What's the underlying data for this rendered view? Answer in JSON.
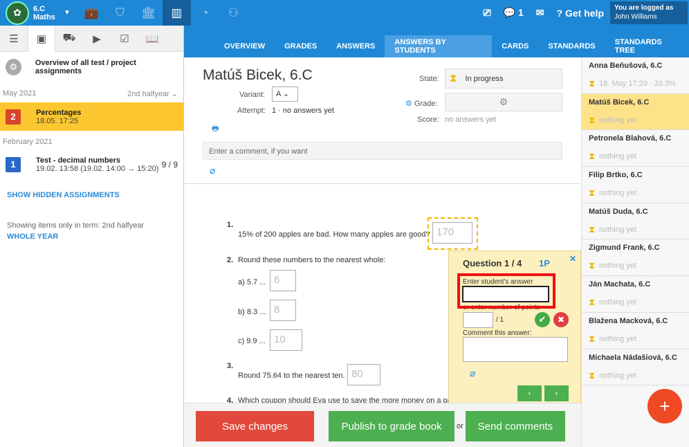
{
  "topbar": {
    "class_name": "6.C",
    "subject": "Maths",
    "unread_count": "1",
    "help": "Get help",
    "logged_as": "You are logged as",
    "user": "John Williams"
  },
  "left": {
    "overview": "Overview of all test / project assignments",
    "sec1": "May 2021",
    "term": "2nd halfyear",
    "a1": {
      "num": "2",
      "title": "Percentages",
      "date": "18.05. 17:25"
    },
    "sec2": "February 2021",
    "a2": {
      "num": "1",
      "title": "Test - decimal numbers",
      "date": "19.02. 13:58 (19.02. 14:00 → 15:20)",
      "score": "9 / 9"
    },
    "show_hidden": "SHOW HIDDEN ASSIGNMENTS",
    "showing": "Showing items only in term: 2nd halfyear",
    "whole_year": "WHOLE YEAR"
  },
  "tabs": [
    "OVERVIEW",
    "GRADES",
    "ANSWERS",
    "ANSWERS BY STUDENTS",
    "CARDS",
    "STANDARDS",
    "STANDARDS TREE"
  ],
  "main": {
    "student": "Matúš Bicek, 6.C",
    "variant_lbl": "Variant:",
    "variant": "A",
    "attempt_lbl": "Attempt:",
    "attempt": "1 · no answers yet",
    "state_lbl": "State:",
    "state": "In progress",
    "grade_lbl": "Grade:",
    "score_lbl": "Score:",
    "score": "no answers yet",
    "comment_placeholder": "Enter a comment, if you want"
  },
  "questions": {
    "q1": "1.",
    "q1t": "15% of 200 apples are bad. How many apples are good?",
    "a1": "170",
    "q2": "2.",
    "q2t": "Round these numbers to the nearest whole:",
    "q2a": "a) 5.7 ...",
    "v2a": "6",
    "q2b": "b) 8.3 ...",
    "v2b": "8",
    "q2c": "c) 9.9 ...",
    "v2c": "10",
    "q3": "3.",
    "q3t": "Round 75.64 to the nearest ten.",
    "a3": "80",
    "q4": "4.",
    "q4t": "Which coupon should Eva use to save the more money on a pa"
  },
  "popup": {
    "title": "Question 1 / 4",
    "points": "1P",
    "enter_answer": "Enter student's answer",
    "enter_points": "or enter number of points",
    "max": "/ 1",
    "comment": "Comment this answer:"
  },
  "buttons": {
    "save": "Save changes",
    "publish": "Publish to grade book",
    "or": "or",
    "send": "Send comments"
  },
  "students": [
    {
      "name": "Anna Beňušová, 6.C",
      "status": "18. May 17:29 · 33.3%"
    },
    {
      "name": "Matúš Bicek, 6.C",
      "status": "nothing yet"
    },
    {
      "name": "Petronela Blahová, 6.C",
      "status": "nothing yet"
    },
    {
      "name": "Filip Brtko, 6.C",
      "status": "nothing yet"
    },
    {
      "name": "Matúš Duda, 6.C",
      "status": "nothing yet"
    },
    {
      "name": "Zigmund Frank, 6.C",
      "status": "nothing yet"
    },
    {
      "name": "Ján Machata, 6.C",
      "status": "nothing yet"
    },
    {
      "name": "Blažena Macková, 6.C",
      "status": "nothing yet"
    },
    {
      "name": "Michaela Nádašiová, 6.C",
      "status": "nothing yet"
    }
  ]
}
